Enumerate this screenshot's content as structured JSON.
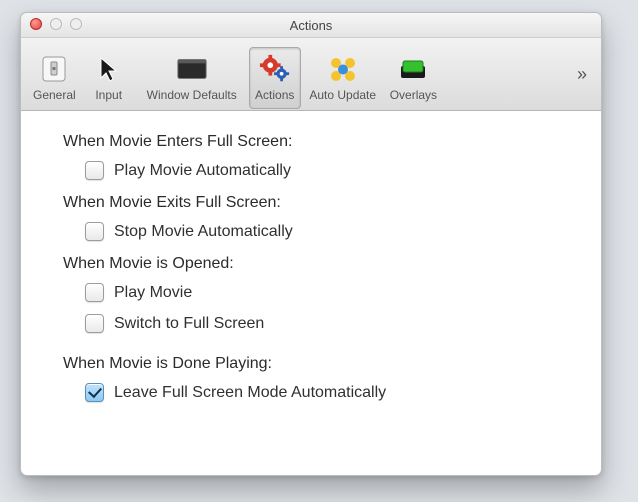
{
  "window": {
    "title": "Actions"
  },
  "toolbar": {
    "items": [
      {
        "id": "general",
        "label": "General",
        "selected": false
      },
      {
        "id": "input",
        "label": "Input",
        "selected": false
      },
      {
        "id": "window-defaults",
        "label": "Window Defaults",
        "selected": false
      },
      {
        "id": "actions",
        "label": "Actions",
        "selected": true
      },
      {
        "id": "auto-update",
        "label": "Auto Update",
        "selected": false
      },
      {
        "id": "overlays",
        "label": "Overlays",
        "selected": false
      }
    ],
    "overflow_glyph": "»"
  },
  "sections": [
    {
      "title": "When Movie Enters Full Screen:",
      "options": [
        {
          "id": "play-auto-enter",
          "label": "Play Movie Automatically",
          "checked": false
        }
      ]
    },
    {
      "title": "When Movie Exits Full Screen:",
      "options": [
        {
          "id": "stop-auto-exit",
          "label": "Stop Movie Automatically",
          "checked": false
        }
      ]
    },
    {
      "title": "When Movie is Opened:",
      "options": [
        {
          "id": "play-on-open",
          "label": "Play Movie",
          "checked": false
        },
        {
          "id": "switch-fs",
          "label": "Switch to Full Screen",
          "checked": false
        }
      ]
    },
    {
      "title": "When Movie is Done Playing:",
      "spaced": true,
      "options": [
        {
          "id": "leave-fs-auto",
          "label": "Leave Full Screen Mode Automatically",
          "checked": true
        }
      ]
    }
  ]
}
